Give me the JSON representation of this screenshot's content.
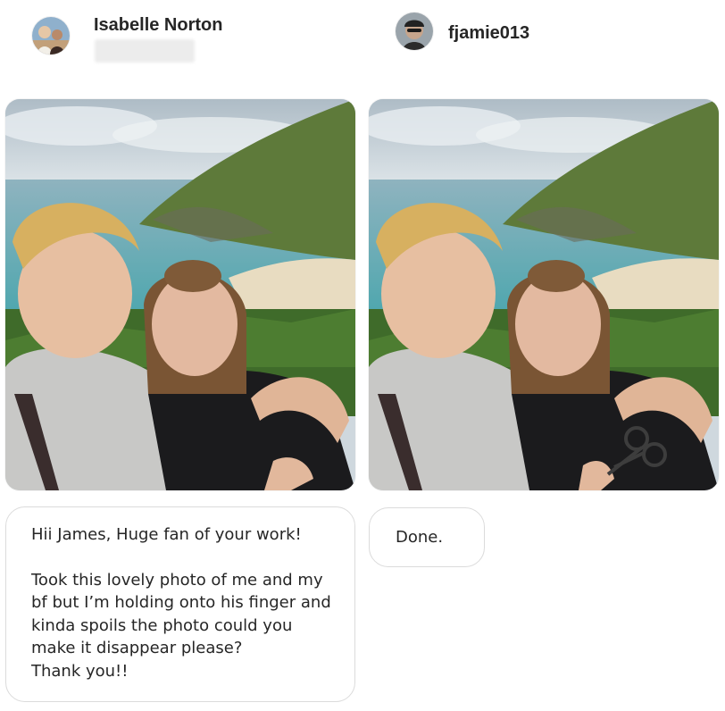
{
  "sender": {
    "name": "Isabelle Norton",
    "message": {
      "line1": "Hii James, Huge fan of your work!",
      "line2": "Took this lovely photo of me and my",
      "line3": "bf but I’m holding onto his finger and",
      "line4": "kinda spoils the photo could you",
      "line5": "make it disappear please?",
      "line6": "Thank you!!"
    }
  },
  "replier": {
    "name": "fjamie013",
    "message": "Done."
  },
  "colors": {
    "bubble_border": "#dbdbdb",
    "name_text": "#262626",
    "sky": "#c9d6de",
    "sea": "#5fa7b4",
    "grass": "#4e7f2f"
  },
  "icons": [
    "avatar-isabelle",
    "avatar-fjamie",
    "scissors-icon"
  ]
}
